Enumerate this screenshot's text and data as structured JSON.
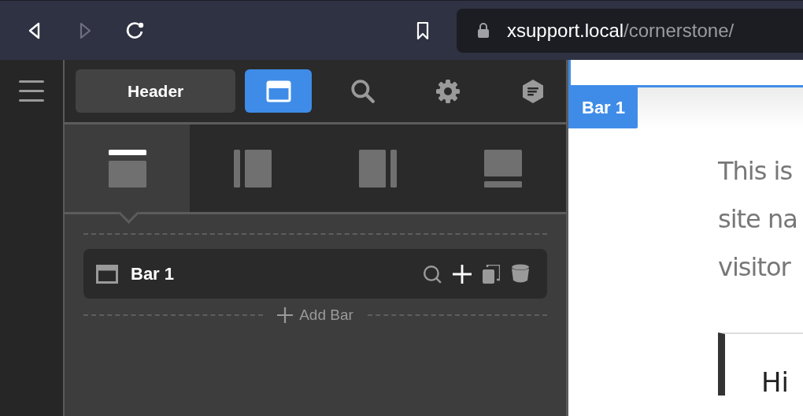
{
  "browser": {
    "url_host": "xsupport.local",
    "url_path": "/cornerstone/"
  },
  "panel": {
    "title": "Header",
    "tools": [
      {
        "kind": "layout",
        "selected": true
      },
      {
        "kind": "search",
        "selected": false
      },
      {
        "kind": "settings",
        "selected": false
      },
      {
        "kind": "docs",
        "selected": false
      }
    ],
    "regions": [
      {
        "kind": "top",
        "selected": true
      },
      {
        "kind": "left",
        "selected": false
      },
      {
        "kind": "right",
        "selected": false
      },
      {
        "kind": "bottom",
        "selected": false
      }
    ],
    "bars": [
      {
        "label": "Bar 1"
      }
    ],
    "add_bar": "Add Bar"
  },
  "preview": {
    "bar_tag": "Bar 1",
    "lines": [
      "This is",
      "site na",
      "visitor"
    ],
    "card_text": "Hi"
  }
}
